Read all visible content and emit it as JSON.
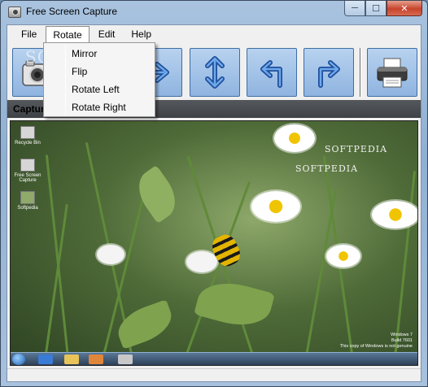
{
  "window": {
    "title": "Free Screen Capture"
  },
  "caption_buttons": {
    "minimize": "─",
    "maximize": "☐",
    "close": "✕"
  },
  "menubar": {
    "items": [
      {
        "label": "File"
      },
      {
        "label": "Rotate"
      },
      {
        "label": "Edit"
      },
      {
        "label": "Help"
      }
    ]
  },
  "rotate_menu": {
    "items": [
      {
        "label": "Mirror"
      },
      {
        "label": "Flip"
      },
      {
        "label": "Rotate Left"
      },
      {
        "label": "Rotate Right"
      }
    ]
  },
  "toolbar": {
    "buttons": [
      {
        "icon": "camera-icon"
      },
      {
        "icon": "mirror-arrow-icon"
      },
      {
        "icon": "flip-arrow-icon"
      },
      {
        "icon": "rotate-left-icon"
      },
      {
        "icon": "rotate-right-icon"
      },
      {
        "icon": "printer-icon"
      }
    ]
  },
  "capture_panel": {
    "label": "Captur"
  },
  "screenshot": {
    "watermark_1": "SOFTPEDIA",
    "watermark_2": "SOFTPEDIA",
    "overlay_watermark": "SOFTPEDIA",
    "desktop_icons": [
      {
        "label": "Recycle Bin"
      },
      {
        "label": "Free Screen Capture"
      },
      {
        "label": "Softpedia"
      }
    ],
    "win_version": [
      "Windows 7",
      "Build 7601",
      "This copy of Windows is not genuine"
    ]
  },
  "colors": {
    "toolbar_button": "#9dbfe8",
    "arrow": "#1f4f9c",
    "capture_bar": "#4a4d50"
  }
}
